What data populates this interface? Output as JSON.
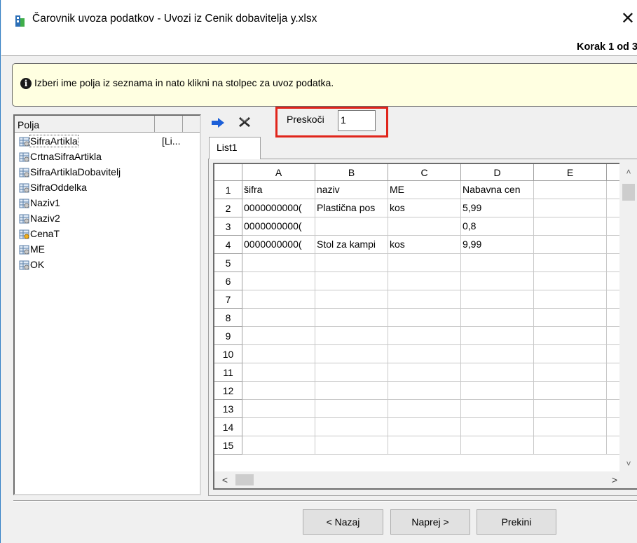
{
  "window": {
    "title": "Čarovnik uvoza podatkov - Uvozi iz Cenik dobavitelja y.xlsx",
    "close_glyph": "✕",
    "step": "Korak 1 od 3"
  },
  "info": {
    "icon": "info-icon",
    "text": "Izberi ime polja iz seznama in nato klikni na stolpec za uvoz podatka."
  },
  "fields": {
    "header": "Polja",
    "items": [
      {
        "label": "SifraArtikla",
        "value": "[Li...",
        "icon": "field-icon",
        "selected": true
      },
      {
        "label": "CrtnaSifraArtikla",
        "value": "",
        "icon": "field-icon"
      },
      {
        "label": "SifraArtiklaDobavitelj",
        "value": "",
        "icon": "field-icon"
      },
      {
        "label": "SifraOddelka",
        "value": "",
        "icon": "field-icon"
      },
      {
        "label": "Naziv1",
        "value": "",
        "icon": "field-icon"
      },
      {
        "label": "Naziv2",
        "value": "",
        "icon": "field-icon"
      },
      {
        "label": "CenaT",
        "value": "",
        "icon": "key-field-icon"
      },
      {
        "label": "ME",
        "value": "",
        "icon": "field-icon"
      },
      {
        "label": "OK",
        "value": "",
        "icon": "field-icon"
      }
    ]
  },
  "toolbar": {
    "assign_icon": "arrow-right-icon",
    "clear_icon": "clear-x-icon",
    "skip_label": "Preskoči",
    "skip_value": "1"
  },
  "tabs": [
    {
      "label": "List1"
    }
  ],
  "grid": {
    "columns": [
      "A",
      "B",
      "C",
      "D",
      "E"
    ],
    "rows": [
      {
        "num": "1",
        "cells": [
          "šifra",
          "naziv",
          "ME",
          "Nabavna cen",
          ""
        ]
      },
      {
        "num": "2",
        "cells": [
          "0000000000(",
          "Plastična pos",
          "kos",
          "5,99",
          ""
        ]
      },
      {
        "num": "3",
        "cells": [
          "0000000000(",
          "",
          "",
          "0,8",
          ""
        ]
      },
      {
        "num": "4",
        "cells": [
          "0000000000(",
          "Stol za kampi",
          "kos",
          "9,99",
          ""
        ]
      },
      {
        "num": "5",
        "cells": [
          "",
          "",
          "",
          "",
          ""
        ]
      },
      {
        "num": "6",
        "cells": [
          "",
          "",
          "",
          "",
          ""
        ]
      },
      {
        "num": "7",
        "cells": [
          "",
          "",
          "",
          "",
          ""
        ]
      },
      {
        "num": "8",
        "cells": [
          "",
          "",
          "",
          "",
          ""
        ]
      },
      {
        "num": "9",
        "cells": [
          "",
          "",
          "",
          "",
          ""
        ]
      },
      {
        "num": "10",
        "cells": [
          "",
          "",
          "",
          "",
          ""
        ]
      },
      {
        "num": "11",
        "cells": [
          "",
          "",
          "",
          "",
          ""
        ]
      },
      {
        "num": "12",
        "cells": [
          "",
          "",
          "",
          "",
          ""
        ]
      },
      {
        "num": "13",
        "cells": [
          "",
          "",
          "",
          "",
          ""
        ]
      },
      {
        "num": "14",
        "cells": [
          "",
          "",
          "",
          "",
          ""
        ]
      },
      {
        "num": "15",
        "cells": [
          "",
          "",
          "",
          "",
          ""
        ]
      }
    ]
  },
  "buttons": {
    "back": "< Nazaj",
    "next": "Naprej >",
    "cancel": "Prekini"
  },
  "colors": {
    "info_background": "#ffffe1",
    "highlight_border": "#e0251b",
    "arrow_blue": "#1c5fd8"
  }
}
